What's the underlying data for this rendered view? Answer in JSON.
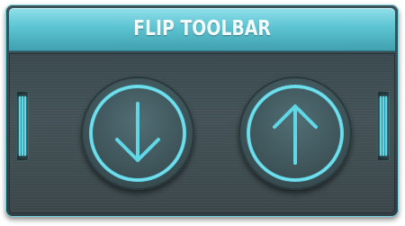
{
  "toolbar": {
    "title": "FLIP TOOLBAR",
    "accent_color": "#5fd7e6",
    "buttons": [
      {
        "name": "flip-down-button",
        "icon": "arrow-down-icon"
      },
      {
        "name": "flip-up-button",
        "icon": "arrow-up-icon"
      }
    ],
    "grips": [
      "grip-left-icon",
      "grip-right-icon"
    ]
  }
}
